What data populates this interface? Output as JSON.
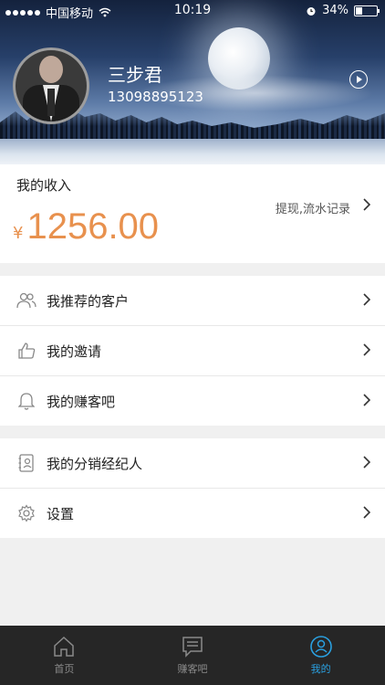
{
  "status_bar": {
    "carrier": "中国移动",
    "time": "10:19",
    "battery": "34%",
    "battery_level": 0.34
  },
  "profile": {
    "name": "三步君",
    "phone": "13098895123"
  },
  "income": {
    "title": "我的收入",
    "link": "提现,流水记录",
    "currency": "¥",
    "amount": "1256.00"
  },
  "menu_group_1": [
    {
      "label": "我推荐的客户",
      "icon": "users-icon"
    },
    {
      "label": "我的邀请",
      "icon": "thumbs-up-icon"
    },
    {
      "label": "我的赚客吧",
      "icon": "bell-icon"
    }
  ],
  "menu_group_2": [
    {
      "label": "我的分销经纪人",
      "icon": "contact-card-icon"
    },
    {
      "label": "设置",
      "icon": "gear-icon"
    }
  ],
  "tabs": [
    {
      "label": "首页",
      "icon": "home-icon",
      "active": false
    },
    {
      "label": "赚客吧",
      "icon": "chat-icon",
      "active": false
    },
    {
      "label": "我的",
      "icon": "profile-icon",
      "active": true
    }
  ],
  "colors": {
    "accent": "#2aa0e0",
    "amount": "#e8914e",
    "tabbar": "#262626"
  }
}
